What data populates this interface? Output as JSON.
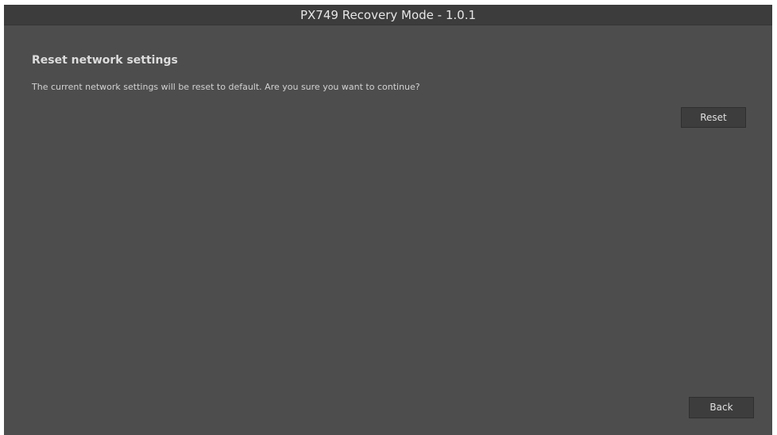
{
  "window": {
    "title": "PX749 Recovery Mode - 1.0.1"
  },
  "main": {
    "heading": "Reset network settings",
    "message": "The current network settings will be reset to default. Are you sure you want to continue?",
    "reset_label": "Reset",
    "back_label": "Back"
  },
  "colors": {
    "background": "#4d4d4d",
    "titlebar": "#3c3c3c",
    "button": "#3d3d3d",
    "text": "#dcdcdc"
  }
}
